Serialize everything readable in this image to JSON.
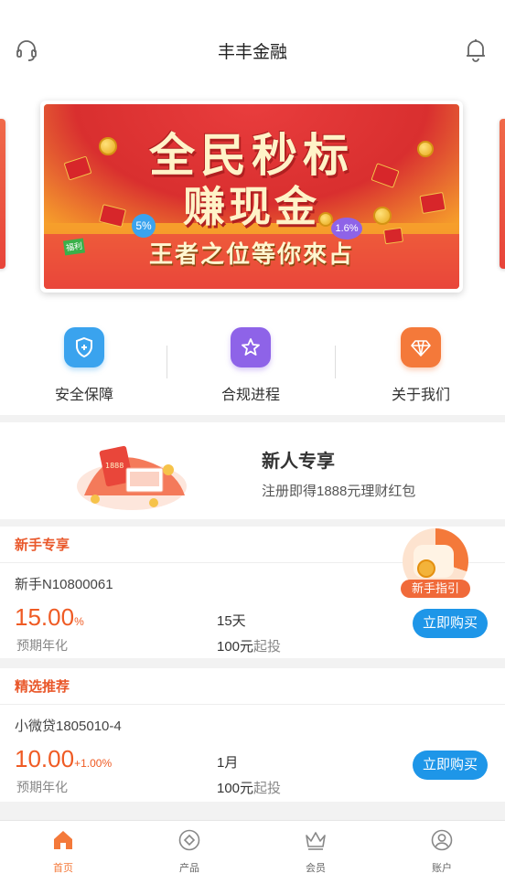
{
  "header": {
    "title": "丰丰金融",
    "left_icon": "headset-icon",
    "right_icon": "bell-icon"
  },
  "banner": {
    "line1": "全民秒标",
    "line2": "赚现金",
    "line3": "王者之位等你來占",
    "tags": [
      "5%",
      "1.6%",
      "福利"
    ]
  },
  "features": [
    {
      "label": "安全保障",
      "icon": "shield-icon",
      "color": "#3aa3ee"
    },
    {
      "label": "合规进程",
      "icon": "star-icon",
      "color": "#8e63e8"
    },
    {
      "label": "关于我们",
      "icon": "diamond-icon",
      "color": "#f4793a"
    }
  ],
  "newbie": {
    "title": "新人专享",
    "subtitle": "注册即得1888元理财红包",
    "art_text": "1888"
  },
  "products": [
    {
      "section": "新手专享",
      "name": "新手N10800061",
      "rate": "15.00",
      "rate_unit": "%",
      "rate_bonus": "",
      "rate_label": "预期年化",
      "term": "15天",
      "min_amount": "100元",
      "min_suffix": "起投",
      "button": "立即购买"
    },
    {
      "section": "精选推荐",
      "name": "小微贷1805010-4",
      "rate": "10.00",
      "rate_unit": "",
      "rate_bonus": "+1.00%",
      "rate_label": "预期年化",
      "term": "1月",
      "min_amount": "100元",
      "min_suffix": "起投",
      "button": "立即购买"
    }
  ],
  "guide": {
    "label": "新手指引"
  },
  "tabs": [
    {
      "label": "首页",
      "icon": "home-icon",
      "active": true
    },
    {
      "label": "产品",
      "icon": "product-icon",
      "active": false
    },
    {
      "label": "会员",
      "icon": "crown-icon",
      "active": false
    },
    {
      "label": "账户",
      "icon": "user-icon",
      "active": false
    }
  ],
  "colors": {
    "accent": "#f4793a",
    "button": "#1e96e8",
    "rate": "#ef5b24"
  }
}
